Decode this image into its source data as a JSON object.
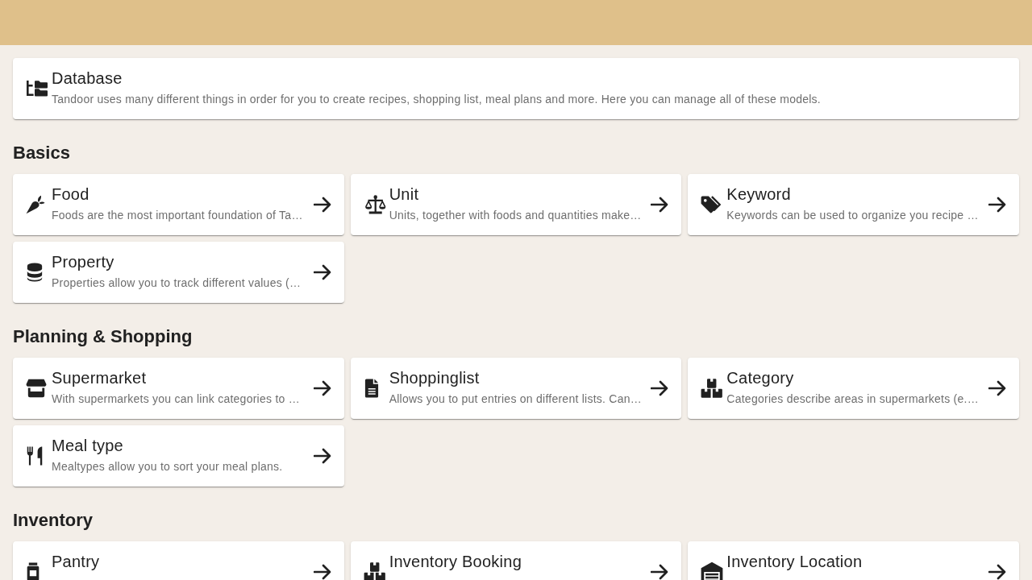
{
  "database_card": {
    "title": "Database",
    "description": "Tandoor uses many different things in order for you to create recipes, shopping list, meal plans and more. Here you can manage all of these models."
  },
  "sections": [
    {
      "heading": "Basics",
      "cards": [
        {
          "title": "Food",
          "description": "Foods are the most important foundation of Ta…"
        },
        {
          "title": "Unit",
          "description": "Units, together with foods and quantities make…"
        },
        {
          "title": "Keyword",
          "description": "Keywords can be used to organize you recipe …"
        },
        {
          "title": "Property",
          "description": "Properties allow you to track different values (…"
        }
      ]
    },
    {
      "heading": "Planning & Shopping",
      "cards": [
        {
          "title": "Supermarket",
          "description": "With supermarkets you can link categories to …"
        },
        {
          "title": "Shoppinglist",
          "description": "Allows you to put entries on different lists. Can…"
        },
        {
          "title": "Category",
          "description": "Categories describe areas in supermarkets (e.…"
        },
        {
          "title": "Meal type",
          "description": "Mealtypes allow you to sort your meal plans."
        }
      ]
    },
    {
      "heading": "Inventory",
      "cards": [
        {
          "title": "Pantry"
        },
        {
          "title": "Inventory Booking"
        },
        {
          "title": "Inventory Location"
        }
      ]
    }
  ]
}
